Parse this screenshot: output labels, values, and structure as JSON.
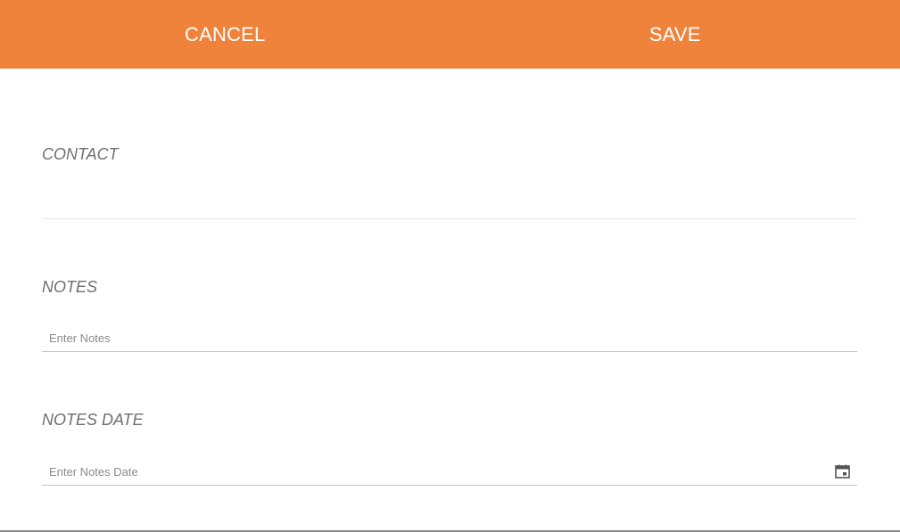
{
  "header": {
    "cancel_label": "CANCEL",
    "save_label": "SAVE",
    "background_color": "#ef833b",
    "text_color": "#ffffff"
  },
  "form": {
    "contact": {
      "label": "CONTACT",
      "value": ""
    },
    "notes": {
      "label": "NOTES",
      "placeholder": "Enter Notes",
      "value": ""
    },
    "notes_date": {
      "label": "NOTES DATE",
      "placeholder": "Enter Notes Date",
      "value": "",
      "icon": "calendar-icon"
    }
  }
}
